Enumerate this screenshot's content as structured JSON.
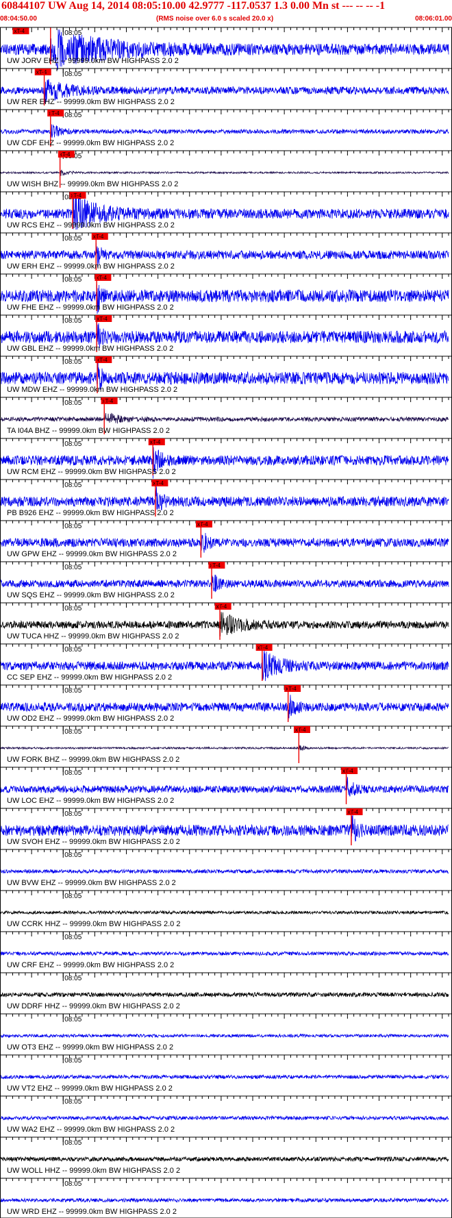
{
  "header": {
    "title": "60844107 UW Aug 14, 2014 08:05:10.00   42.9777 -117.0537  1.3 0.00 Mn st --- -- --  -1",
    "start_time": "08:04:50.00",
    "note": "(RMS noise over 6.0 s scaled 20.0 x)",
    "end_time": "08:06:01.00"
  },
  "colors": {
    "blue": "#0000ee",
    "dark": "#1a0a4a",
    "black": "#000000",
    "pick": "#ee0000",
    "title": "#e00000"
  },
  "chart_data": {
    "type": "seismogram",
    "time_start": "08:04:50.00",
    "time_end": "08:06:01.00",
    "minute_label": "08:05",
    "pick_label": "xT-4",
    "stations": [
      {
        "label": "UW JORV EHZ -- 99999.0km BW  HIGHPASS  2.0  2",
        "color": "blue",
        "pick_s": 2.0,
        "arrival_s": 8.0,
        "amp": 18,
        "decay": 8.0
      },
      {
        "label": "UW RER EHZ -- 99999.0km BW  HIGHPASS  2.0  2",
        "color": "blue",
        "pick_s": 5.5,
        "arrival_s": 7.0,
        "amp": 12,
        "decay": 3.0
      },
      {
        "label": "UW CDF EHZ -- 99999.0km BW  HIGHPASS  2.0  2",
        "color": "blue",
        "pick_s": 7.5,
        "arrival_s": 8.0,
        "amp": 7,
        "decay": 1.5
      },
      {
        "label": "UW WISH BHZ -- 99999.0km BW  HIGHPASS  2.0  2",
        "color": "dark",
        "pick_s": 9.2,
        "arrival_s": 9.5,
        "amp": 3,
        "decay": 1.0
      },
      {
        "label": "UW RCS EHZ -- 99999.0km BW  HIGHPASS  2.0  2",
        "color": "blue",
        "pick_s": 11.0,
        "arrival_s": 11.5,
        "amp": 16,
        "decay": 4.0
      },
      {
        "label": "UW ERH EHZ -- 99999.0km BW  HIGHPASS  2.0  2",
        "color": "blue",
        "pick_s": 14.5,
        "arrival_s": 15.2,
        "amp": 14,
        "decay": 0.6
      },
      {
        "label": "UW FHE EHZ -- 99999.0km BW  HIGHPASS  2.0  2",
        "color": "blue",
        "pick_s": 15.0,
        "arrival_s": 15.3,
        "amp": 20,
        "decay": 0.5
      },
      {
        "label": "UW GBL EHZ -- 99999.0km BW  HIGHPASS  2.0  2",
        "color": "blue",
        "pick_s": 15.1,
        "arrival_s": 15.3,
        "amp": 20,
        "decay": 0.5
      },
      {
        "label": "UW MDW EHZ -- 99999.0km BW  HIGHPASS  2.0  2",
        "color": "blue",
        "pick_s": 15.1,
        "arrival_s": 15.4,
        "amp": 20,
        "decay": 0.5
      },
      {
        "label": "TA I04A BHZ -- 99999.0km BW  HIGHPASS  2.0  2",
        "color": "dark",
        "pick_s": 16.0,
        "arrival_s": 16.5,
        "amp": 7,
        "decay": 2.0
      },
      {
        "label": "UW RCM EHZ -- 99999.0km BW  HIGHPASS  2.0  2",
        "color": "blue",
        "pick_s": 23.5,
        "arrival_s": 24.2,
        "amp": 16,
        "decay": 1.0
      },
      {
        "label": "PB B926 EHZ -- 99999.0km BW  HIGHPASS  2.0  2",
        "color": "blue",
        "pick_s": 24.0,
        "arrival_s": 24.6,
        "amp": 16,
        "decay": 0.8
      },
      {
        "label": "UW GPW EHZ -- 99999.0km BW  HIGHPASS  2.0  2",
        "color": "blue",
        "pick_s": 31.0,
        "arrival_s": 31.8,
        "amp": 14,
        "decay": 0.8
      },
      {
        "label": "UW SQS EHZ -- 99999.0km BW  HIGHPASS  2.0  2",
        "color": "blue",
        "pick_s": 33.0,
        "arrival_s": 33.5,
        "amp": 12,
        "decay": 0.8
      },
      {
        "label": "UW TUCA HHZ -- 99999.0km BW  HIGHPASS  2.0  2",
        "color": "black",
        "pick_s": 34.0,
        "arrival_s": 34.8,
        "amp": 12,
        "decay": 3.0
      },
      {
        "label": "CC SEP EHZ -- 99999.0km BW  HIGHPASS  2.0  2",
        "color": "blue",
        "pick_s": 40.5,
        "arrival_s": 41.5,
        "amp": 14,
        "decay": 2.5
      },
      {
        "label": "UW OD2 EHZ -- 99999.0km BW  HIGHPASS  2.0  2",
        "color": "blue",
        "pick_s": 45.0,
        "arrival_s": 45.6,
        "amp": 14,
        "decay": 0.8
      },
      {
        "label": "UW FORK BHZ -- 99999.0km BW  HIGHPASS  2.0  2",
        "color": "dark",
        "pick_s": 46.5,
        "arrival_s": 47.3,
        "amp": 3,
        "decay": 0.8
      },
      {
        "label": "UW LOC EHZ -- 99999.0km BW  HIGHPASS  2.0  2",
        "color": "blue",
        "pick_s": 54.0,
        "arrival_s": 54.8,
        "amp": 12,
        "decay": 1.0
      },
      {
        "label": "UW SVOH EHZ -- 99999.0km BW  HIGHPASS  2.0  2",
        "color": "blue",
        "pick_s": 54.8,
        "arrival_s": 55.6,
        "amp": 18,
        "decay": 0.6
      },
      {
        "label": "UW BVW EHZ -- 99999.0km BW  HIGHPASS  2.0  2",
        "color": "blue",
        "amp": 6
      },
      {
        "label": "UW CCRK HHZ -- 99999.0km BW  HIGHPASS  2.0  2",
        "color": "black",
        "amp": 5
      },
      {
        "label": "UW CRF EHZ -- 99999.0km BW  HIGHPASS  2.0  2",
        "color": "blue",
        "amp": 6
      },
      {
        "label": "UW DDRF HHZ -- 99999.0km BW  HIGHPASS  2.0  2",
        "color": "black",
        "amp": 7
      },
      {
        "label": "UW OT3 EHZ -- 99999.0km BW  HIGHPASS  2.0  2",
        "color": "blue",
        "amp": 5
      },
      {
        "label": "UW VT2 EHZ -- 99999.0km BW  HIGHPASS  2.0  2",
        "color": "blue",
        "amp": 6
      },
      {
        "label": "UW WA2 EHZ -- 99999.0km BW  HIGHPASS  2.0  2",
        "color": "blue",
        "amp": 6
      },
      {
        "label": "UW WOLL HHZ -- 99999.0km BW  HIGHPASS  2.0  2",
        "color": "black",
        "amp": 7
      },
      {
        "label": "UW WRD EHZ -- 99999.0km BW  HIGHPASS  2.0  2",
        "color": "blue",
        "amp": 6
      }
    ]
  }
}
